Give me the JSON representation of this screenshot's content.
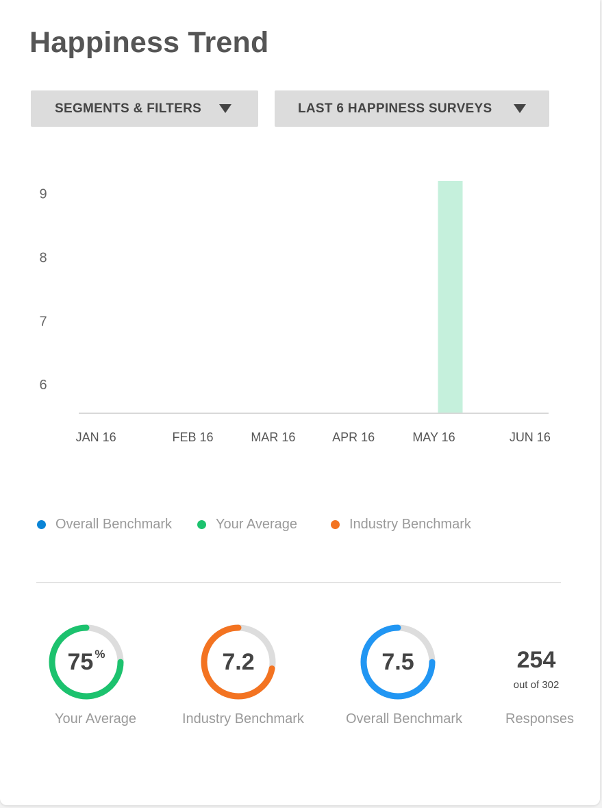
{
  "title": "Happiness Trend",
  "filters": {
    "segments_label": "SEGMENTS & FILTERS",
    "period_label": "LAST 6 HAPPINESS SURVEYS"
  },
  "chart_data": {
    "type": "bar",
    "categories": [
      "JAN 16",
      "FEB 16",
      "MAR 16",
      "APR 16",
      "MAY 16",
      "JUN 16"
    ],
    "values": [
      null,
      null,
      null,
      null,
      9.2,
      null
    ],
    "y_ticks": [
      6,
      7,
      8,
      9
    ],
    "ylim": [
      5.55,
      9.35
    ],
    "bar_color": "#c5f0dc",
    "grid": false,
    "legend_position": "bottom",
    "legend": [
      {
        "name": "Overall Benchmark",
        "color": "#0a84d6"
      },
      {
        "name": "Your Average",
        "color": "#1cc26e"
      },
      {
        "name": "Industry Benchmark",
        "color": "#f37321"
      }
    ]
  },
  "stats": {
    "your_average": {
      "value": "75",
      "unit": "%",
      "label": "Your Average",
      "fraction": 0.75,
      "color": "#1cc26e"
    },
    "industry_benchmark": {
      "value": "7.2",
      "label": "Industry Benchmark",
      "fraction": 0.72,
      "color": "#f37321"
    },
    "overall_benchmark": {
      "value": "7.5",
      "label": "Overall Benchmark",
      "fraction": 0.75,
      "color": "#2196f3"
    },
    "responses": {
      "count": "254",
      "sub": "out of 302",
      "label": "Responses"
    }
  }
}
